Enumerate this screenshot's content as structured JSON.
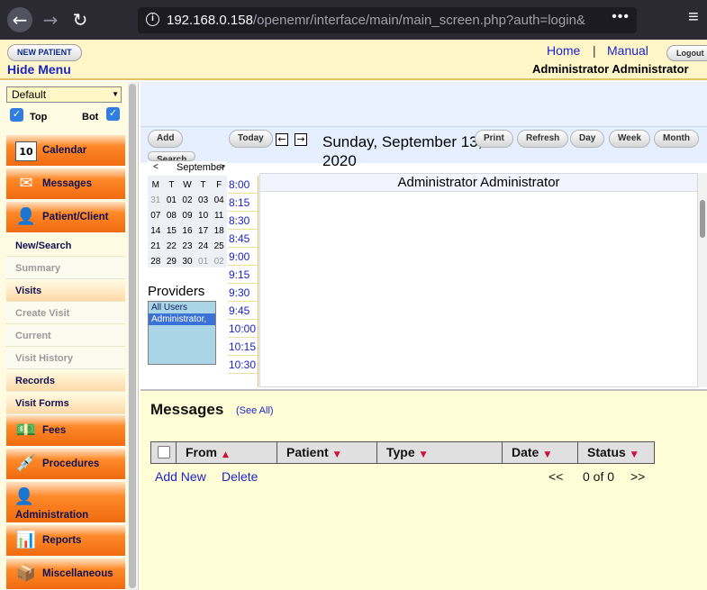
{
  "browser": {
    "url_host": "192.168.0.158",
    "url_path": "/openemr/interface/main/main_screen.php?auth=login&"
  },
  "header": {
    "new_patient": "NEW PATIENT",
    "hide_menu": "Hide Menu",
    "home": "Home",
    "separator": "|",
    "manual": "Manual",
    "logout": "Logout",
    "user": "Administrator Administrator"
  },
  "sidebar": {
    "facility": "Default",
    "top_label": "Top",
    "bot_label": "Bot",
    "items": [
      {
        "label": "Calendar",
        "icon": "calendar-icon"
      },
      {
        "label": "Messages",
        "icon": "envelope-icon"
      },
      {
        "label": "Patient/Client",
        "icon": "person-icon"
      },
      {
        "label": "New/Search"
      },
      {
        "label": "Summary"
      },
      {
        "label": "Visits"
      },
      {
        "label": "Create Visit"
      },
      {
        "label": "Current"
      },
      {
        "label": "Visit History"
      },
      {
        "label": "Records"
      },
      {
        "label": "Visit Forms"
      },
      {
        "label": "Fees",
        "icon": "money-icon"
      },
      {
        "label": "Procedures",
        "icon": "syringe-icon"
      },
      {
        "label": "Administration",
        "icon": "admin-icon"
      },
      {
        "label": "Reports",
        "icon": "bar-chart-icon"
      },
      {
        "label": "Miscellaneous",
        "icon": "box-icon"
      }
    ]
  },
  "calendar": {
    "buttons": {
      "add": "Add",
      "today": "Today",
      "search": "Search",
      "print": "Print",
      "refresh": "Refresh",
      "day": "Day",
      "week": "Week",
      "month": "Month"
    },
    "date_title": "Sunday, September 13, 2020",
    "mini": {
      "prev": "<",
      "month": "September",
      "next": ">",
      "weekdays": [
        "M",
        "T",
        "W",
        "T",
        "F"
      ],
      "weeks": [
        [
          "31",
          "01",
          "02",
          "03",
          "04"
        ],
        [
          "07",
          "08",
          "09",
          "10",
          "11"
        ],
        [
          "14",
          "15",
          "16",
          "17",
          "18"
        ],
        [
          "21",
          "22",
          "23",
          "24",
          "25"
        ],
        [
          "28",
          "29",
          "30",
          "01",
          "02"
        ]
      ]
    },
    "providers_label": "Providers",
    "providers": [
      "All Users",
      "Administrator,"
    ],
    "times": [
      "8:00",
      "8:15",
      "8:30",
      "8:45",
      "9:00",
      "9:15",
      "9:30",
      "9:45",
      "10:00",
      "10:15",
      "10:30"
    ],
    "provider_column": "Administrator Administrator"
  },
  "messages": {
    "title": "Messages",
    "see_all": "(See All)",
    "columns": [
      "From",
      "Patient",
      "Type",
      "Date",
      "Status"
    ],
    "add_new": "Add New",
    "delete": "Delete",
    "pager_prev": "<<",
    "pager_count": "0 of 0",
    "pager_next": ">>"
  }
}
